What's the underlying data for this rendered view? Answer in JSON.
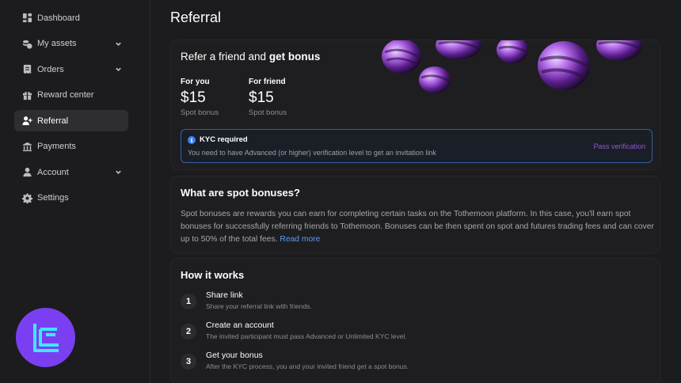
{
  "sidebar": {
    "items": [
      {
        "label": "Dashboard",
        "icon": "dashboard-icon",
        "expandable": false,
        "active": false
      },
      {
        "label": "My assets",
        "icon": "coins-icon",
        "expandable": true,
        "active": false
      },
      {
        "label": "Orders",
        "icon": "orders-icon",
        "expandable": true,
        "active": false
      },
      {
        "label": "Reward center",
        "icon": "gift-icon",
        "expandable": false,
        "active": false
      },
      {
        "label": "Referral",
        "icon": "add-user-icon",
        "expandable": false,
        "active": true
      },
      {
        "label": "Payments",
        "icon": "bank-icon",
        "expandable": false,
        "active": false
      },
      {
        "label": "Account",
        "icon": "user-icon",
        "expandable": true,
        "active": false
      },
      {
        "label": "Settings",
        "icon": "gear-icon",
        "expandable": false,
        "active": false
      }
    ]
  },
  "page": {
    "title": "Referral"
  },
  "refer": {
    "title_prefix": "Refer a friend and ",
    "title_bold": "get bonus",
    "you": {
      "label": "For you",
      "amount": "$15",
      "sub": "Spot bonus"
    },
    "friend": {
      "label": "For friend",
      "amount": "$15",
      "sub": "Spot bonus"
    },
    "kyc": {
      "title": "KYC required",
      "text": "You need to have Advanced (or higher) verification level to get an invitation link",
      "link": "Pass verification"
    }
  },
  "spot": {
    "title": "What are spot bonuses?",
    "body": "Spot bonuses are rewards you can earn for completing certain tasks on the Tothemoon platform. In this case, you'll earn spot bonuses for successfully referring friends to Tothemoon. Bonuses can be then spent on spot and futures trading fees and can cover up to 50% of the total fees.",
    "read_more": "Read more"
  },
  "how": {
    "title": "How it works",
    "steps": [
      {
        "num": "1",
        "title": "Share link",
        "desc": "Share your referral link with friends."
      },
      {
        "num": "2",
        "title": "Create an account",
        "desc": "The invited participant must pass Advanced or Unlimited KYC level."
      },
      {
        "num": "3",
        "title": "Get your bonus",
        "desc": "After the KYC process, you and your invited friend get a spot bonus."
      }
    ]
  },
  "colors": {
    "accent_purple": "#7b3ff2",
    "kyc_border": "#3560a8",
    "link_blue": "#5b9cf0"
  }
}
